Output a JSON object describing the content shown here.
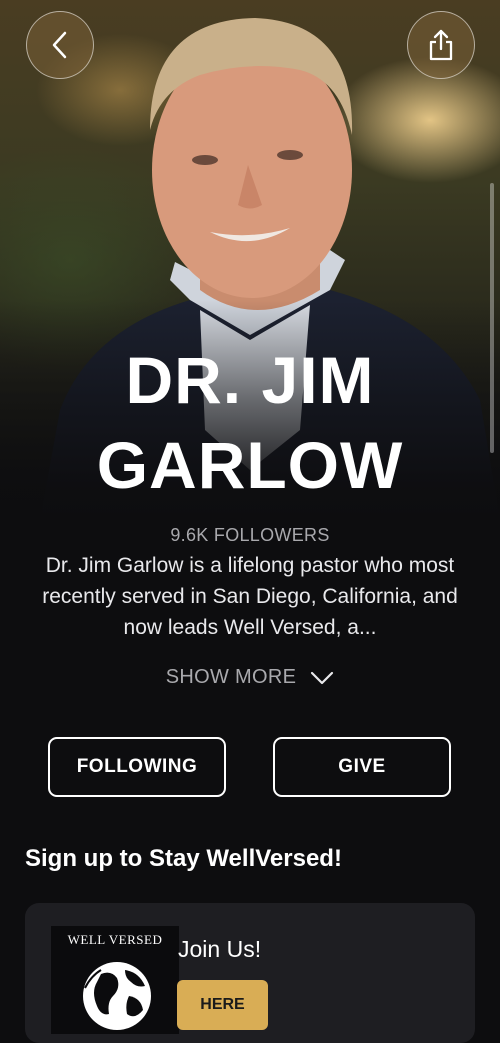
{
  "header": {
    "back_icon": "chevron-left-icon",
    "share_icon": "share-icon"
  },
  "profile": {
    "name_line1": "DR. JIM",
    "name_line2": "GARLOW",
    "followers": "9.6K FOLLOWERS",
    "bio": "Dr. Jim Garlow is a lifelong pastor who most recently served in San Diego, California, and now leads Well Versed, a...",
    "show_more_label": "SHOW MORE",
    "show_more_icon": "chevron-down-icon"
  },
  "actions": {
    "following_label": "FOLLOWING",
    "give_label": "GIVE"
  },
  "signup": {
    "title": "Sign up to Stay WellVersed!",
    "card_title": "Join Us!",
    "button_label": "HERE",
    "thumb_logo_text": "WELL VERSED",
    "button_color": "#d9ad55"
  },
  "colors": {
    "background": "#0d0d0f",
    "card": "#1e1e22",
    "accent": "#d9ad55"
  }
}
